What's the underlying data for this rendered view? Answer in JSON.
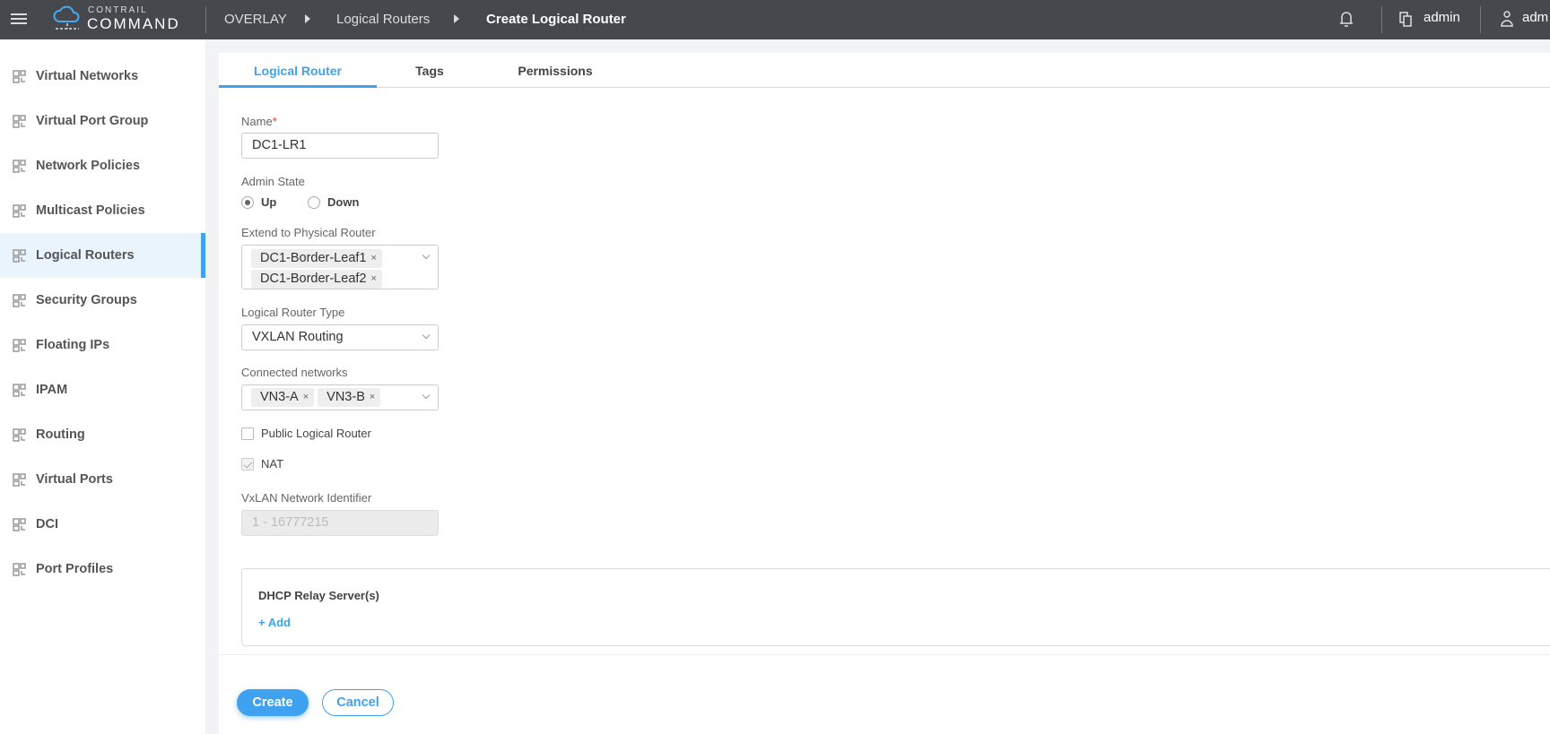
{
  "header": {
    "logo_top": "CONTRAIL",
    "logo_bottom": "COMMAND",
    "breadcrumb": [
      "OVERLAY",
      "Logical Routers",
      "Create Logical Router"
    ],
    "project": "admin",
    "user": "adm"
  },
  "sidebar": {
    "items": [
      {
        "label": "Virtual Networks",
        "icon": "virtual-networks-icon"
      },
      {
        "label": "Virtual Port Group",
        "icon": "port-group-icon"
      },
      {
        "label": "Network Policies",
        "icon": "policy-icon"
      },
      {
        "label": "Multicast Policies",
        "icon": "multicast-icon"
      },
      {
        "label": "Logical Routers",
        "icon": "router-icon",
        "active": true
      },
      {
        "label": "Security Groups",
        "icon": "security-icon"
      },
      {
        "label": "Floating IPs",
        "icon": "floating-ip-icon"
      },
      {
        "label": "IPAM",
        "icon": "ipam-icon"
      },
      {
        "label": "Routing",
        "icon": "routing-icon"
      },
      {
        "label": "Virtual Ports",
        "icon": "virtual-port-icon"
      },
      {
        "label": "DCI",
        "icon": "dci-icon"
      },
      {
        "label": "Port Profiles",
        "icon": "port-profile-icon"
      }
    ]
  },
  "tabs": [
    "Logical Router",
    "Tags",
    "Permissions"
  ],
  "form": {
    "name_label": "Name",
    "required_mark": "*",
    "name_value": "DC1-LR1",
    "admin_state_label": "Admin State",
    "admin_up": "Up",
    "admin_down": "Down",
    "extend_label": "Extend to Physical Router",
    "extend_values": [
      "DC1-Border-Leaf1",
      "DC1-Border-Leaf2"
    ],
    "type_label": "Logical Router Type",
    "type_value": "VXLAN Routing",
    "networks_label": "Connected networks",
    "networks_values": [
      "VN3-A",
      "VN3-B"
    ],
    "public_label": "Public Logical Router",
    "nat_label": "NAT",
    "vni_label": "VxLAN Network Identifier",
    "vni_placeholder": "1 - 16777215",
    "dhcp_title": "DHCP Relay Server(s)",
    "dhcp_add": "+ Add",
    "remove_glyph": "×"
  },
  "actions": {
    "create": "Create",
    "cancel": "Cancel"
  }
}
